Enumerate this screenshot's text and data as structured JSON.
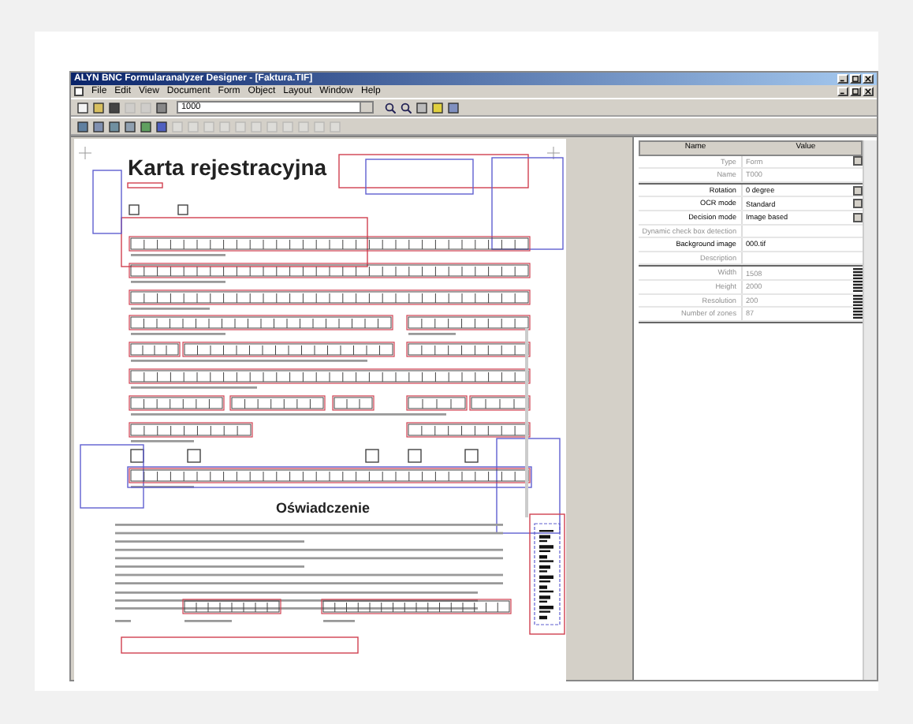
{
  "window": {
    "title": "ALYN BNC Formularanalyzer Designer - [Faktura.TIF]"
  },
  "menu": [
    "File",
    "Edit",
    "View",
    "Document",
    "Form",
    "Object",
    "Layout",
    "Window",
    "Help"
  ],
  "zoom_field": {
    "value": "1000"
  },
  "document": {
    "title": "Karta rejestracyjna",
    "section_title": "Oświadczenie"
  },
  "properties": {
    "columns": [
      "Name",
      "Value"
    ],
    "groups": [
      [
        {
          "name": "Type",
          "value": "Form",
          "kind": "combo",
          "disabled": true
        },
        {
          "name": "Name",
          "value": "T000",
          "kind": "plain",
          "disabled": true
        }
      ],
      [
        {
          "name": "Rotation",
          "value": "0 degree",
          "kind": "combo",
          "disabled": false
        },
        {
          "name": "OCR mode",
          "value": "Standard",
          "kind": "combo",
          "disabled": false
        },
        {
          "name": "Decision mode",
          "value": "Image based",
          "kind": "combo",
          "disabled": false
        },
        {
          "name": "Dynamic check box detection",
          "kind": "plain",
          "disabled": true
        },
        {
          "name": "Background image",
          "value": "000.tif",
          "kind": "plain",
          "disabled": false
        },
        {
          "name": "Description",
          "kind": "plain",
          "disabled": true
        }
      ],
      [
        {
          "name": "Width",
          "value": "1508",
          "kind": "spin",
          "disabled": true
        },
        {
          "name": "Height",
          "value": "2000",
          "kind": "spin",
          "disabled": true
        },
        {
          "name": "Resolution",
          "value": "200",
          "kind": "spin",
          "disabled": true
        },
        {
          "name": "Number of zones",
          "value": "87",
          "kind": "spin",
          "disabled": true
        }
      ]
    ]
  }
}
